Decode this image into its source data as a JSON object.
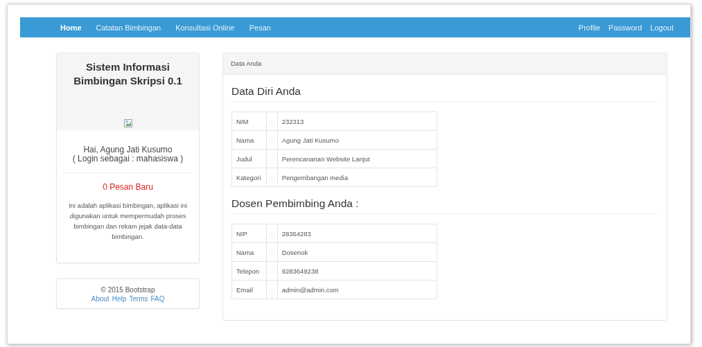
{
  "navbar": {
    "left_items": [
      {
        "label": "Home",
        "selected": true
      },
      {
        "label": "Catatan Bimbingan",
        "selected": false
      },
      {
        "label": "Konsultasi Online",
        "selected": false
      },
      {
        "label": "Pesan",
        "selected": false
      }
    ],
    "right_items": [
      {
        "label": "Profile",
        "selected": false
      },
      {
        "label": "Password",
        "selected": false
      },
      {
        "label": "Logout",
        "selected": false
      }
    ]
  },
  "sidebar": {
    "title": "Sistem Informasi Bimbingan Skripsi 0.1",
    "greeting": "Hai, Agung Jati Kusumo",
    "role": "( Login sebagai : mahasiswa )",
    "messages": "0 Pesan Baru",
    "description": "Ini adalah aplikasi bimbingan, aplikasi ini digunakan untuk mempermudah proses bimbingan dan rekam jejak data-data bimbingan."
  },
  "footer": {
    "copyright": "© 2015 Bootstrap",
    "links": [
      "About",
      "Help",
      "Terms",
      "FAQ"
    ]
  },
  "panel": {
    "heading": "Data Anda",
    "sections": [
      {
        "title": "Data Diri Anda",
        "rows": [
          {
            "label": "NIM",
            "separator": ":",
            "value": "232313"
          },
          {
            "label": "Nama",
            "separator": ":",
            "value": "Agung Jati Kusumo"
          },
          {
            "label": "Judul",
            "separator": ":",
            "value": "Perencananan Website Lanjut"
          },
          {
            "label": "Kategori",
            "separator": ":",
            "value": "Pengembangan media"
          }
        ]
      },
      {
        "title": "Dosen Pembimbing Anda :",
        "rows": [
          {
            "label": "NIP",
            "separator": ":",
            "value": "28364283"
          },
          {
            "label": "Nama",
            "separator": ":",
            "value": "Dosenok"
          },
          {
            "label": "Telepon",
            "separator": ":",
            "value": "9283649238"
          },
          {
            "label": "Email",
            "separator": ":",
            "value": "admin@admin.com"
          }
        ]
      }
    ]
  }
}
